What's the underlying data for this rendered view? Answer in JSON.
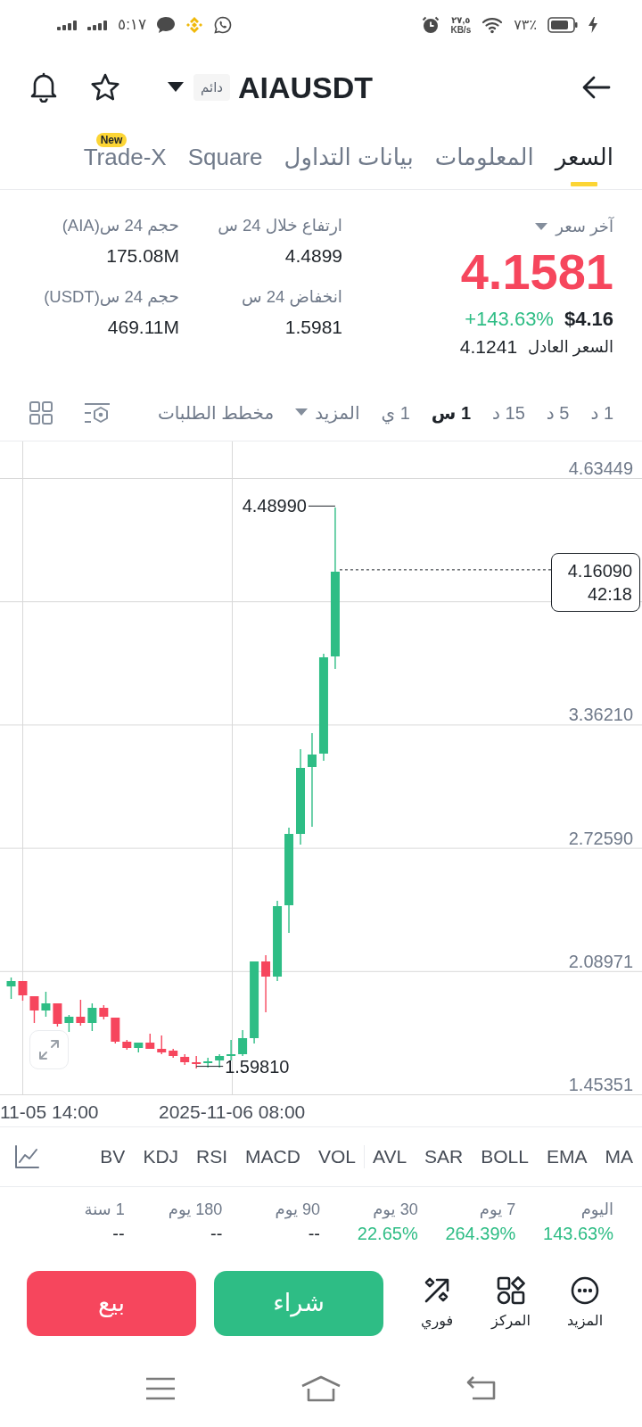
{
  "status_bar": {
    "time": "٥:١٧",
    "speed": "٢٧,٥",
    "speed_unit": "KB/s",
    "battery": "٧٣٪"
  },
  "header": {
    "symbol": "AIAUSDT",
    "tag": "دائم"
  },
  "tabs": [
    {
      "label": "السعر",
      "selected": true
    },
    {
      "label": "المعلومات",
      "selected": false
    },
    {
      "label": "بيانات التداول",
      "selected": false
    },
    {
      "label": "Square",
      "selected": false
    },
    {
      "label": "Trade-X",
      "selected": false,
      "badge": "New"
    }
  ],
  "ticker": {
    "label": "آخر سعر",
    "last_price": "4.1581",
    "price_falling": true,
    "change": "+143.63%",
    "change_positive": true,
    "usd_price": "$4.16",
    "fair_price_label": "السعر العادل",
    "fair_price": "4.1241"
  },
  "stats": [
    {
      "label": "ارتفاع خلال 24 س",
      "value": "4.4899"
    },
    {
      "label": "حجم 24 س(AIA)",
      "value": "175.08M"
    },
    {
      "label": "انخفاض 24 س",
      "value": "1.5981"
    },
    {
      "label": "حجم 24 س(USDT)",
      "value": "469.11M"
    }
  ],
  "intervals": [
    {
      "label": "1 د",
      "selected": false
    },
    {
      "label": "5 د",
      "selected": false
    },
    {
      "label": "15 د",
      "selected": false
    },
    {
      "label": "1 س",
      "selected": true
    },
    {
      "label": "1 ي",
      "selected": false
    }
  ],
  "chart_menu": {
    "more": "المزيد",
    "depth": "مخطط الطلبات"
  },
  "chart": {
    "price_ticks": [
      "4.63449",
      "3.36210",
      "2.72590",
      "2.08971",
      "1.45351"
    ],
    "time_ticks": [
      "2025-11-06 08:00",
      "11-05 14:00"
    ],
    "high": "4.48990",
    "low": "1.59810",
    "last_price": "4.16090",
    "countdown": "42:18"
  },
  "main_indicators": [
    "MA",
    "EMA",
    "BOLL",
    "SAR",
    "AVL"
  ],
  "sub_indicators": [
    "VOL",
    "MACD",
    "RSI",
    "KDJ",
    "BV"
  ],
  "performance": [
    {
      "period": "اليوم",
      "change": "143.63%",
      "positive": true
    },
    {
      "period": "7 يوم",
      "change": "264.39%",
      "positive": true
    },
    {
      "period": "30 يوم",
      "change": "22.65%",
      "positive": true
    },
    {
      "period": "90 يوم",
      "change": "--",
      "positive": false
    },
    {
      "period": "180 يوم",
      "change": "--",
      "positive": false
    },
    {
      "period": "1 سنة",
      "change": "--",
      "positive": false
    }
  ],
  "actions": [
    {
      "label": "المزيد",
      "kind": "more"
    },
    {
      "label": "المركز",
      "kind": "position"
    },
    {
      "label": "فوري",
      "kind": "instant"
    }
  ],
  "trade_buttons": [
    {
      "label": "شراء",
      "kind": "buy"
    },
    {
      "label": "بيع",
      "kind": "sell"
    }
  ]
}
